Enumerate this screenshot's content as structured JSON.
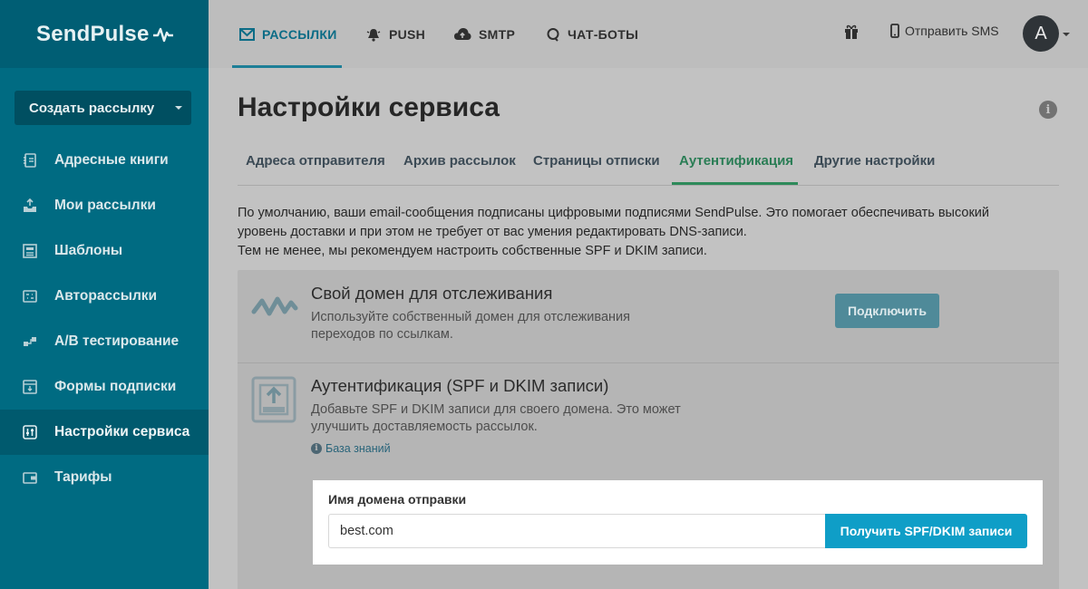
{
  "brand": {
    "name": "SendPulse"
  },
  "sidebar": {
    "create_button": "Создать рассылку",
    "items": [
      {
        "label": "Адресные книги",
        "icon": "address-book-icon"
      },
      {
        "label": "Мои рассылки",
        "icon": "inbox-upload-icon"
      },
      {
        "label": "Шаблоны",
        "icon": "templates-icon"
      },
      {
        "label": "Авторассылки",
        "icon": "automation-icon"
      },
      {
        "label": "A/B тестирование",
        "icon": "ab-test-icon"
      },
      {
        "label": "Формы подписки",
        "icon": "subscribe-form-icon"
      },
      {
        "label": "Настройки сервиса",
        "icon": "settings-sliders-icon",
        "active": true
      },
      {
        "label": "Тарифы",
        "icon": "wallet-icon"
      }
    ]
  },
  "topnav": {
    "items": [
      {
        "label": "РАССЫЛКИ",
        "icon": "envelope-icon",
        "active": true
      },
      {
        "label": "PUSH",
        "icon": "bell-icon"
      },
      {
        "label": "SMTP",
        "icon": "cloud-upload-icon"
      },
      {
        "label": "ЧАТ-БОТЫ",
        "icon": "chat-icon"
      }
    ],
    "sms_label": "Отправить SMS",
    "avatar_letter": "A"
  },
  "main": {
    "title": "Настройки сервиса",
    "tabs": [
      {
        "label": "Адреса отправителя"
      },
      {
        "label": "Архив рассылок"
      },
      {
        "label": "Страницы отписки"
      },
      {
        "label": "Аутентификация",
        "active": true
      },
      {
        "label": "Другие настройки"
      }
    ],
    "intro_line1": "По умолчанию, ваши email-сообщения подписаны цифровыми подписями SendPulse. Это помогает обеспечивать высокий",
    "intro_line2": "уровень доставки и при этом не требует от вас умения редактировать DNS-записи.",
    "intro_line3": "Тем не менее, мы рекомендуем настроить собственные SPF и DKIM записи.",
    "tracking": {
      "title": "Свой домен для отслеживания",
      "desc_line1": "Используйте собственный домен для отслеживания",
      "desc_line2": "переходов по ссылкам.",
      "button": "Подключить"
    },
    "auth": {
      "title": "Аутентификация (SPF и DKIM записи)",
      "desc_line1": "Добавьте SPF и DKIM записи для своего домена. Это может",
      "desc_line2": "улучшить доставляемость рассылок.",
      "kb_link": "База знаний",
      "form_label": "Имя домена отправки",
      "domain_value": "best.com",
      "submit_button": "Получить SPF/DKIM записи"
    }
  },
  "colors": {
    "sidebar_bg": "#006b82",
    "accent_blue": "#0f9ec7",
    "active_tab_green": "#2e8a5a"
  }
}
